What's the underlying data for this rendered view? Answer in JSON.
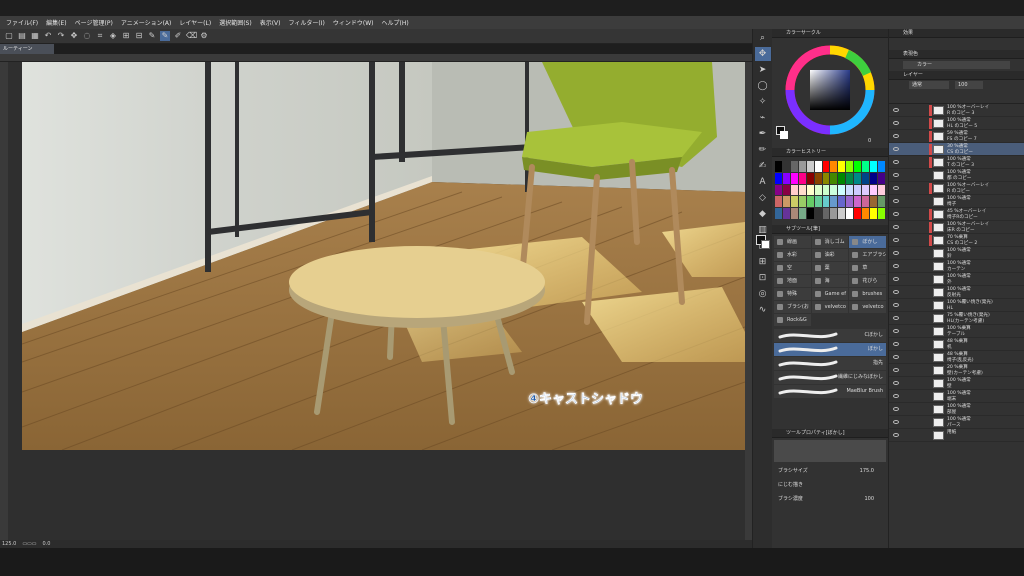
{
  "menu": [
    "ファイル(F)",
    "編集(E)",
    "ページ管理(P)",
    "アニメーション(A)",
    "レイヤー(L)",
    "選択範囲(S)",
    "表示(V)",
    "フィルター(I)",
    "ウィンドウ(W)",
    "ヘルプ(H)"
  ],
  "doc_tab": "ルーティーン",
  "statusbar": {
    "zoom": "125.0",
    "angle": "0.0"
  },
  "caption": "④キャストシャドウ",
  "panels": {
    "color_wheel": "カラーサークル",
    "color_history": "カラーヒストリー",
    "subtool": "サブツール[筆]",
    "tool_property": "ツールプロパティ[ぼかし]",
    "effects": "効果",
    "display_color": "表現色",
    "color_mode": "カラー",
    "layer_tab": "レイヤー",
    "blend": "通常",
    "opacity": "100"
  },
  "subtools": [
    "線画",
    "消しゴム",
    "ぼかし",
    "水彩",
    "油彩",
    "エアブラシ",
    "空",
    "葉",
    "草",
    "地面",
    "海",
    "花びら",
    "特殊",
    "Game ef",
    "brushes",
    "ブラシ(お",
    "velvetco",
    "velvetco",
    "Rock&G"
  ],
  "brushes": [
    "Cぼかし",
    "ぼかし",
    "指先",
    "繊維にじみなぼかし",
    "MaeBlur Brush"
  ],
  "tool_props": {
    "size_label": "ブラシサイズ",
    "size": "175.0",
    "blur_label": "にじむ描き",
    "density_label": "ブラシ濃度",
    "density": "100"
  },
  "layers": [
    {
      "name": "100 %オーバーレイ\nR のコピー 3",
      "red": true,
      "sel": false
    },
    {
      "name": "100 %通常\nHL のコピー 5",
      "red": true,
      "sel": false
    },
    {
      "name": "59 %通常\nFS のコピー 7",
      "red": true,
      "sel": false
    },
    {
      "name": "30 %通常\nCS のコピー",
      "red": true,
      "sel": true
    },
    {
      "name": "100 %通常\nT のコピー 3",
      "red": true,
      "sel": false
    },
    {
      "name": "100 %通常\n都 のコピー",
      "red": false,
      "sel": false
    },
    {
      "name": "100 %オーバーレイ\nR のコピー",
      "red": true,
      "sel": false
    },
    {
      "name": "100 %通常\n椅子",
      "red": false,
      "sel": false
    },
    {
      "name": "45 %オーバーレイ\n椅子Rのコピー",
      "red": true,
      "sel": false
    },
    {
      "name": "100 %オーバーレイ\n床R のコピー",
      "red": true,
      "sel": false
    },
    {
      "name": "70 %乗算\nCS のコピー 2",
      "red": true,
      "sel": false
    },
    {
      "name": "100 %通常\n鈴",
      "red": false,
      "sel": false
    },
    {
      "name": "100 %通常\nカーテン",
      "red": false,
      "sel": false
    },
    {
      "name": "100 %通常\n外",
      "red": false,
      "sel": false
    },
    {
      "name": "100 %通常\n反射光",
      "red": false,
      "sel": false
    },
    {
      "name": "100 %覆い焼き(発光)\nHL",
      "red": false,
      "sel": false
    },
    {
      "name": "75 %覆い焼き(発光)\nHL(カーテン考慮)",
      "red": false,
      "sel": false
    },
    {
      "name": "100 %乗算\nテーブル",
      "red": false,
      "sel": false
    },
    {
      "name": "48 %乗算\n机",
      "red": false,
      "sel": false
    },
    {
      "name": "48 %乗算\n椅子(乱反光)",
      "red": false,
      "sel": false
    },
    {
      "name": "20 %乗算\n壁(カーテン考慮)",
      "red": false,
      "sel": false
    },
    {
      "name": "100 %通常\n壁",
      "red": false,
      "sel": false
    },
    {
      "name": "100 %通常\n端末",
      "red": false,
      "sel": false
    },
    {
      "name": "100 %通常\n部屋",
      "red": false,
      "sel": false
    },
    {
      "name": "100 %通常\nパース",
      "red": false,
      "sel": false
    },
    {
      "name": "用紙",
      "red": false,
      "sel": false
    }
  ],
  "wheel_numbers": {
    "h": "0",
    "s": "0",
    "v": "0"
  }
}
